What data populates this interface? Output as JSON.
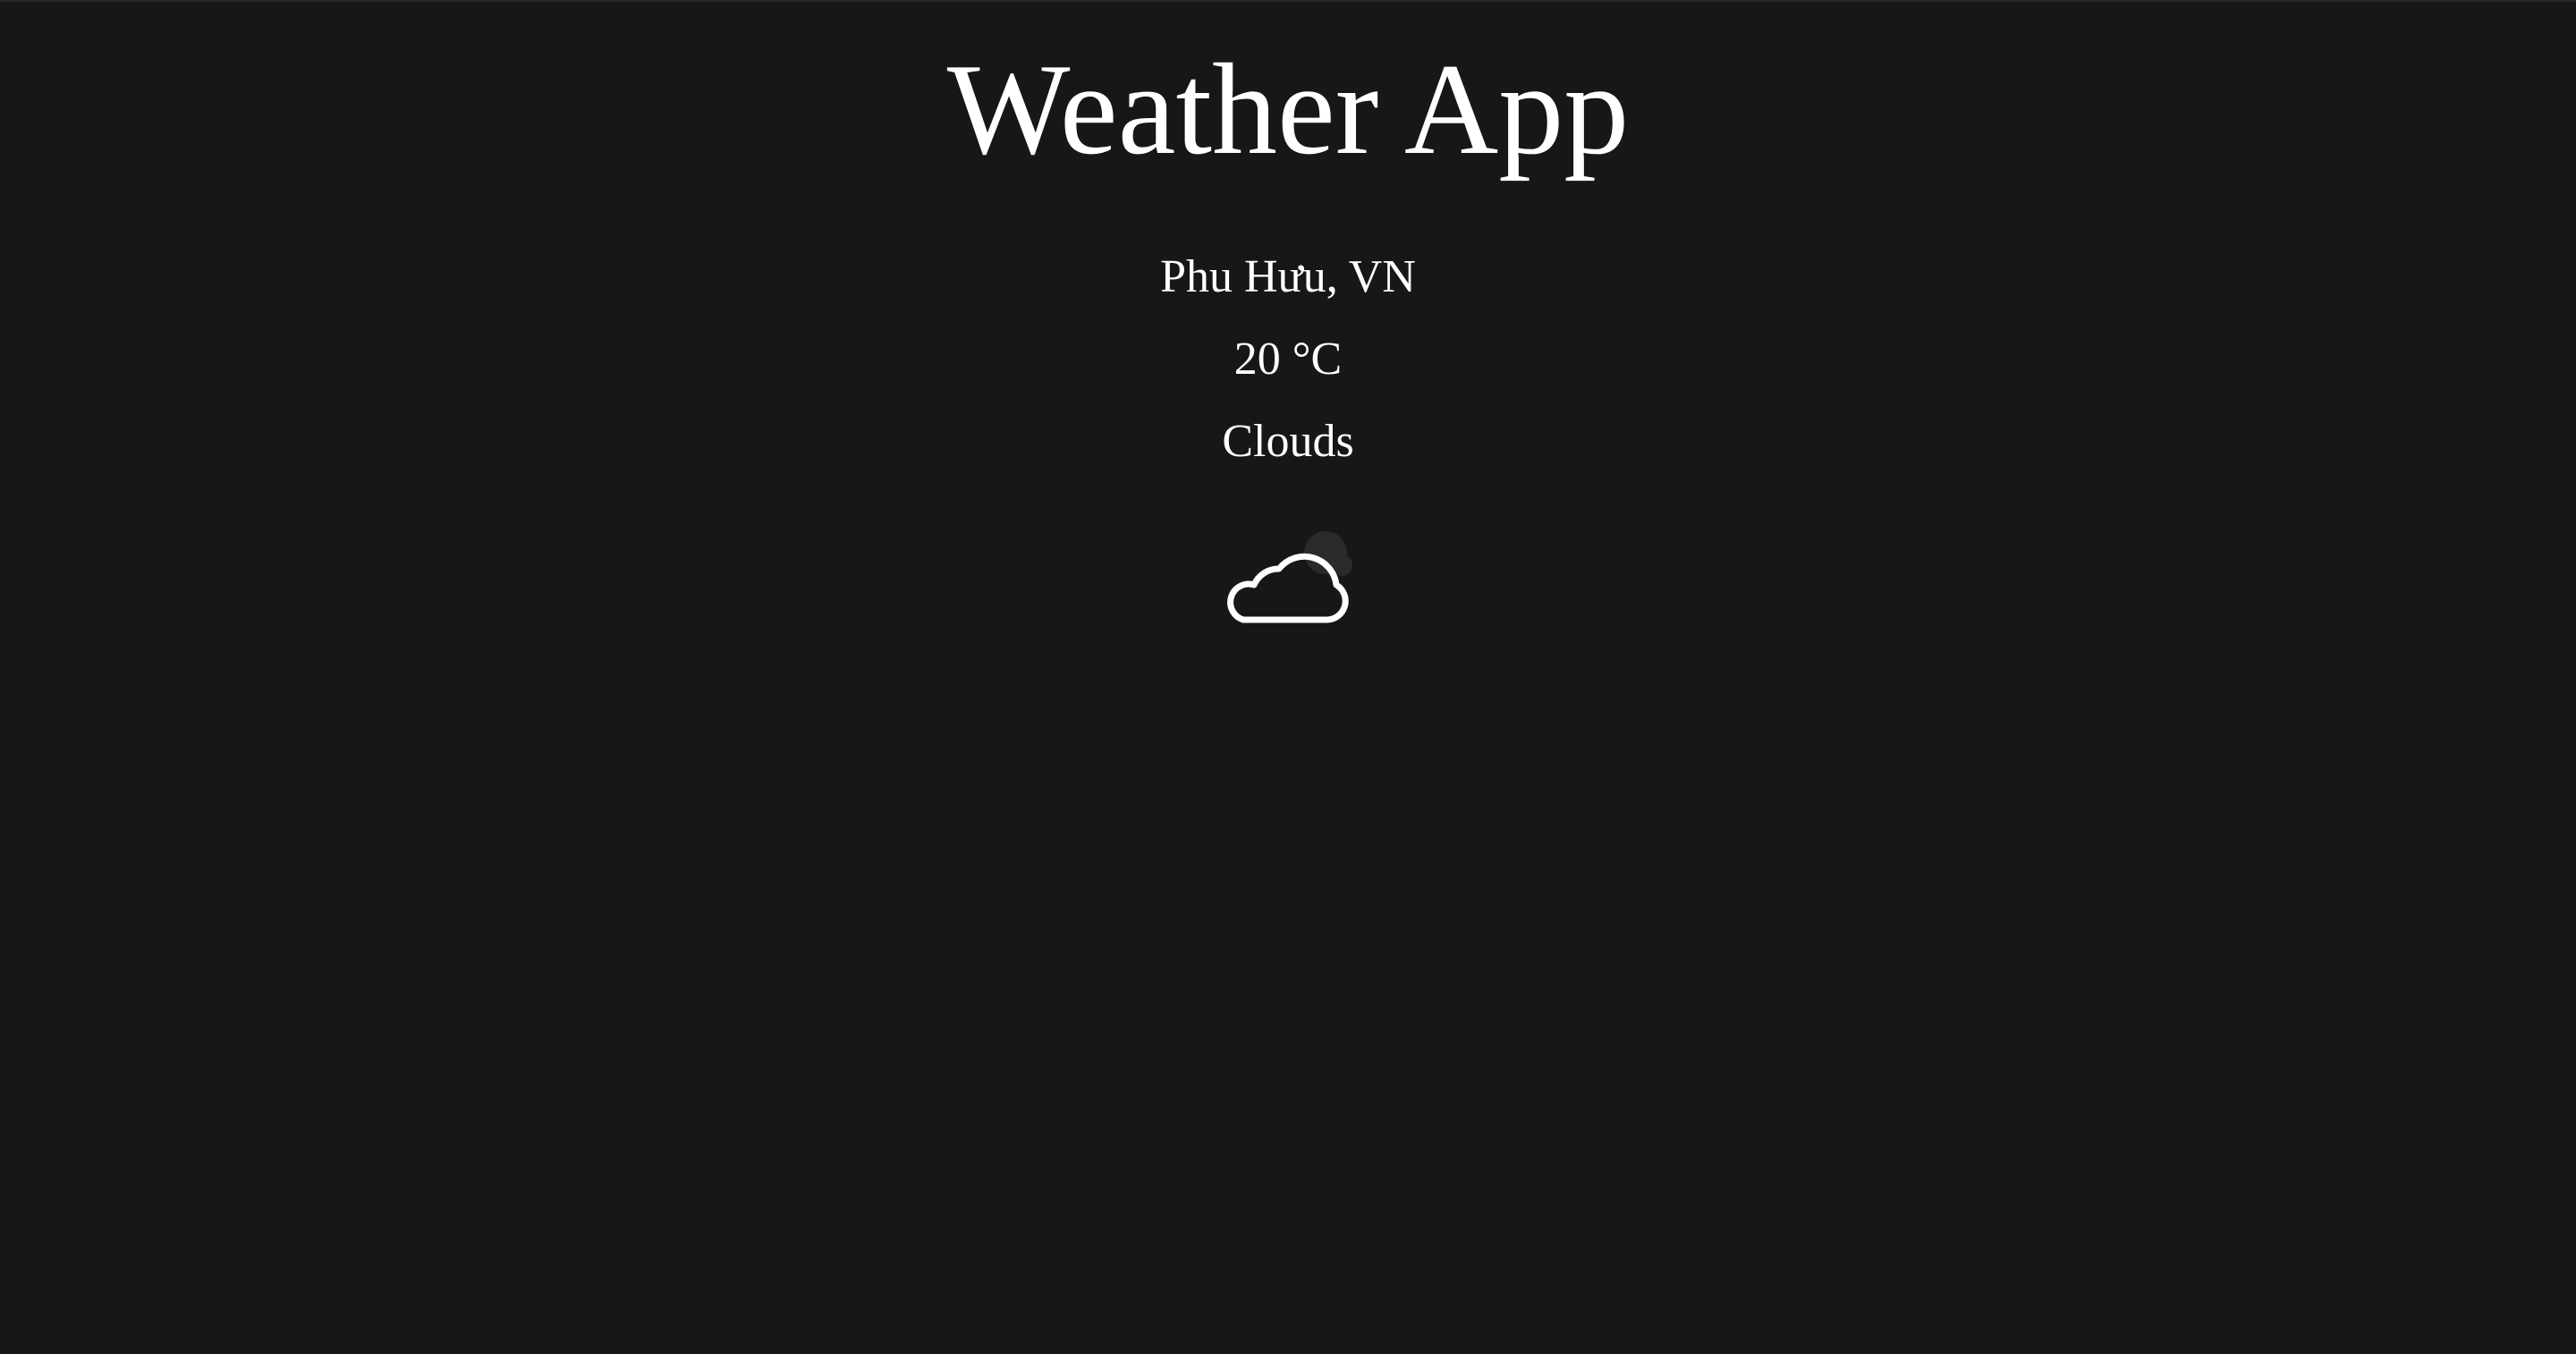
{
  "app": {
    "title": "Weather App"
  },
  "weather": {
    "location": "Phu Hưu, VN",
    "temperature": "20 °C",
    "condition": "Clouds",
    "icon": "cloud-icon"
  },
  "colors": {
    "background": "#171717",
    "text": "#ffffff"
  }
}
